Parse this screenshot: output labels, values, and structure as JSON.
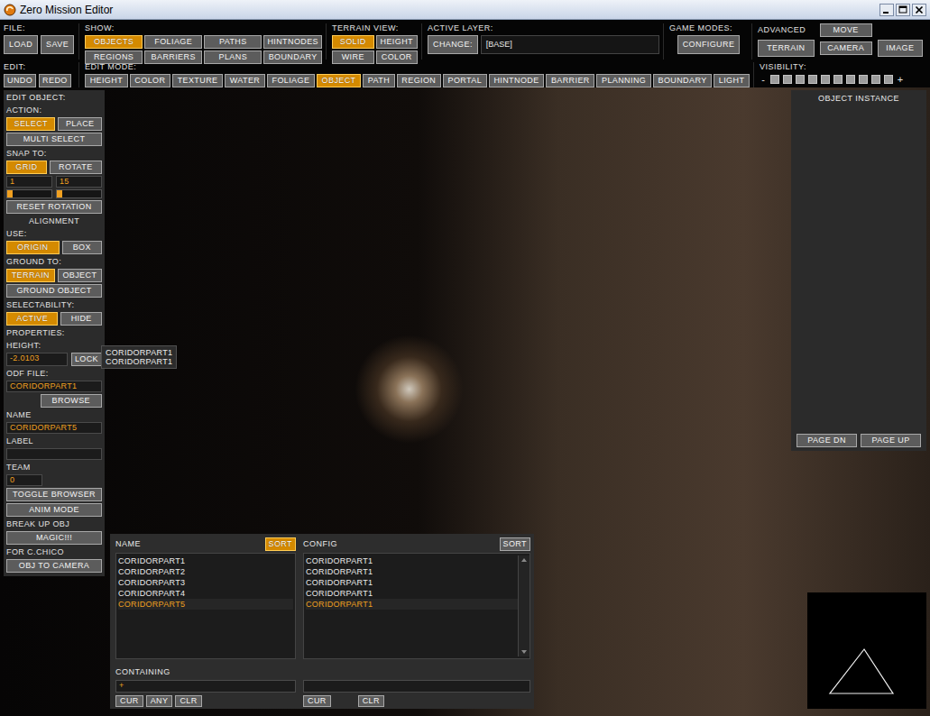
{
  "window": {
    "title": "Zero Mission Editor"
  },
  "toolbar": {
    "file": {
      "label": "FILE:",
      "buttons": [
        "LOAD",
        "SAVE"
      ]
    },
    "show": {
      "label": "SHOW:",
      "buttons": [
        {
          "label": "OBJECTS",
          "selected": true
        },
        {
          "label": "FOLIAGE",
          "selected": false
        },
        {
          "label": "PATHS",
          "selected": false
        },
        {
          "label": "HINTNODES",
          "selected": false
        },
        {
          "label": "REGIONS",
          "selected": false
        },
        {
          "label": "BARRIERS",
          "selected": false
        },
        {
          "label": "PLANS",
          "selected": false
        },
        {
          "label": "BOUNDARY",
          "selected": false
        }
      ]
    },
    "terrain_view": {
      "label": "TERRAIN VIEW:",
      "buttons": [
        {
          "label": "SOLID",
          "selected": true
        },
        {
          "label": "HEIGHT",
          "selected": false
        },
        {
          "label": "WIRE",
          "selected": false
        },
        {
          "label": "COLOR",
          "selected": false
        }
      ]
    },
    "active_layer": {
      "label": "ACTIVE LAYER:",
      "button": "CHANGE:",
      "value": "[BASE]"
    },
    "game_modes": {
      "label": "GAME MODES:",
      "button": "CONFIGURE"
    },
    "advanced": {
      "label": "ADVANCED",
      "terrain": "TERRAIN",
      "move": "MOVE",
      "camera": "CAMERA",
      "image": "IMAGE"
    },
    "edit": {
      "label": "EDIT:",
      "buttons": [
        "UNDO",
        "REDO"
      ]
    },
    "edit_mode": {
      "label": "EDIT MODE:",
      "buttons": [
        {
          "label": "HEIGHT",
          "selected": false
        },
        {
          "label": "COLOR",
          "selected": false
        },
        {
          "label": "TEXTURE",
          "selected": false
        },
        {
          "label": "WATER",
          "selected": false
        },
        {
          "label": "FOLIAGE",
          "selected": false
        },
        {
          "label": "OBJECT",
          "selected": true
        },
        {
          "label": "PATH",
          "selected": false
        },
        {
          "label": "REGION",
          "selected": false
        },
        {
          "label": "PORTAL",
          "selected": false
        },
        {
          "label": "HINTNODE",
          "selected": false
        },
        {
          "label": "BARRIER",
          "selected": false
        },
        {
          "label": "PLANNING",
          "selected": false
        },
        {
          "label": "BOUNDARY",
          "selected": false
        },
        {
          "label": "LIGHT",
          "selected": false
        }
      ]
    },
    "visibility": {
      "label": "VISIBILITY:",
      "minus": "-",
      "plus": "+",
      "boxes": [
        {
          "on": true
        },
        {
          "on": true
        },
        {
          "on": true
        },
        {
          "on": true
        },
        {
          "on": true
        },
        {
          "on": true
        },
        {
          "on": true
        },
        {
          "on": true
        },
        {
          "on": true
        },
        {
          "on": true
        }
      ]
    }
  },
  "edit_object": {
    "title": "EDIT OBJECT:",
    "items": [
      {
        "kind": "label",
        "text": "ACTION:"
      },
      {
        "kind": "buttons",
        "buttons": [
          {
            "label": "SELECT",
            "selected": true
          },
          {
            "label": "PLACE",
            "selected": false
          }
        ]
      },
      {
        "kind": "buttons",
        "buttons": [
          {
            "label": "MULTI SELECT",
            "selected": false
          }
        ]
      },
      {
        "kind": "label",
        "text": "SNAP TO:"
      },
      {
        "kind": "buttons",
        "buttons": [
          {
            "label": "GRID",
            "selected": true
          },
          {
            "label": "ROTATE",
            "selected": false
          }
        ]
      },
      {
        "kind": "fields",
        "fields": [
          {
            "value": "1"
          },
          {
            "value": "15"
          }
        ]
      },
      {
        "kind": "sliders",
        "sliders": [
          {
            "level": 0
          },
          {
            "level": 0
          }
        ]
      },
      {
        "kind": "buttons",
        "buttons": [
          {
            "label": "RESET ROTATION",
            "selected": false
          }
        ]
      },
      {
        "kind": "center_label",
        "text": "ALIGNMENT"
      },
      {
        "kind": "label",
        "text": "USE:"
      },
      {
        "kind": "buttons",
        "buttons": [
          {
            "label": "ORIGIN",
            "selected": true
          },
          {
            "label": "BOX",
            "selected": false
          }
        ]
      },
      {
        "kind": "label",
        "text": "GROUND TO:"
      },
      {
        "kind": "buttons",
        "buttons": [
          {
            "label": "TERRAIN",
            "selected": true
          },
          {
            "label": "OBJECT",
            "selected": false
          }
        ]
      },
      {
        "kind": "buttons",
        "buttons": [
          {
            "label": "GROUND OBJECT",
            "selected": false
          }
        ]
      },
      {
        "kind": "label",
        "text": "SELECTABILITY:"
      },
      {
        "kind": "buttons",
        "buttons": [
          {
            "label": "ACTIVE",
            "selected": true
          },
          {
            "label": "HIDE",
            "selected": false
          }
        ]
      },
      {
        "kind": "label",
        "text": "PROPERTIES:"
      },
      {
        "kind": "label",
        "text": "HEIGHT:"
      },
      {
        "kind": "field_button",
        "value": "-2.0103",
        "button": "LOCK"
      },
      {
        "kind": "label",
        "text": "ODF FILE:"
      },
      {
        "kind": "field",
        "value": "CORIDORPART1"
      },
      {
        "kind": "right_button",
        "label": "BROWSE"
      },
      {
        "kind": "label",
        "text": "NAME"
      },
      {
        "kind": "field",
        "value": "CORIDORPART5"
      },
      {
        "kind": "label",
        "text": "LABEL"
      },
      {
        "kind": "field",
        "value": ""
      },
      {
        "kind": "label",
        "text": "TEAM"
      },
      {
        "kind": "short_field",
        "value": "0"
      },
      {
        "kind": "buttons",
        "buttons": [
          {
            "label": "TOGGLE BROWSER",
            "selected": false
          }
        ]
      },
      {
        "kind": "buttons",
        "buttons": [
          {
            "label": "ANIM MODE",
            "selected": false
          }
        ]
      },
      {
        "kind": "label",
        "text": "BREAK UP OBJ"
      },
      {
        "kind": "buttons",
        "buttons": [
          {
            "label": "MAGIC!!!",
            "selected": false
          }
        ]
      },
      {
        "kind": "label",
        "text": "FOR C.CHICO"
      },
      {
        "kind": "buttons",
        "buttons": [
          {
            "label": "OBJ TO CAMERA",
            "selected": false
          }
        ]
      }
    ]
  },
  "tooltip": {
    "lines": [
      "CORIDORPART1",
      "CORIDORPART1"
    ]
  },
  "object_instance": {
    "title": "OBJECT INSTANCE",
    "buttons": [
      "PAGE DN",
      "PAGE UP"
    ]
  },
  "browser": {
    "name_column": {
      "label": "NAME",
      "sort": {
        "label": "SORT",
        "selected": true
      },
      "rows": [
        {
          "text": "CORIDORPART1",
          "selected": false
        },
        {
          "text": "CORIDORPART2",
          "selected": false
        },
        {
          "text": "CORIDORPART3",
          "selected": false
        },
        {
          "text": "CORIDORPART4",
          "selected": false
        },
        {
          "text": "CORIDORPART5",
          "selected": true
        }
      ]
    },
    "config_column": {
      "label": "CONFIG",
      "sort": {
        "label": "SORT",
        "selected": false
      },
      "rows": [
        {
          "text": "CORIDORPART1",
          "selected": false
        },
        {
          "text": "CORIDORPART1",
          "selected": false
        },
        {
          "text": "CORIDORPART1",
          "selected": false
        },
        {
          "text": "CORIDORPART1",
          "selected": false
        },
        {
          "text": "CORIDORPART1",
          "selected": true
        }
      ]
    },
    "containing": {
      "label": "CONTAINING",
      "fields": [
        "+",
        ""
      ],
      "left_buttons": [
        "CUR",
        "ANY",
        "CLR"
      ],
      "right_buttons": [
        "CUR",
        "CLR"
      ]
    }
  }
}
